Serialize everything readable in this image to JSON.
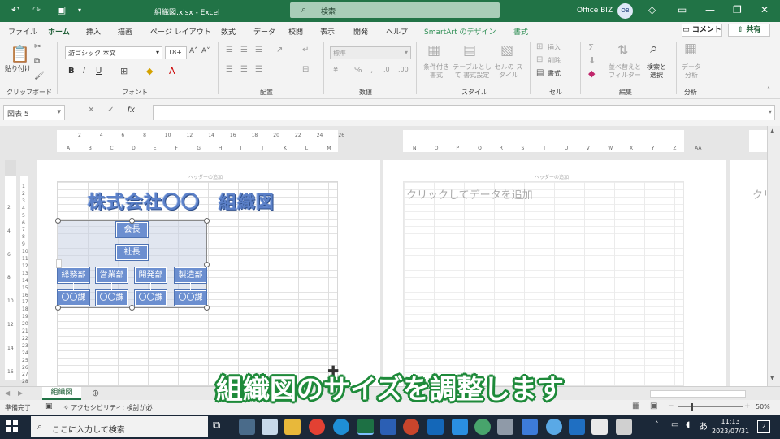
{
  "titlebar": {
    "file_title": "組織図.xlsx - Excel",
    "search_label": "検索",
    "user_name": "Office BIZ",
    "avatar_initials": "OB",
    "accent": "#217346"
  },
  "menu": {
    "tabs": [
      "ファイル",
      "ホーム",
      "挿入",
      "描画",
      "ページ レイアウト",
      "数式",
      "データ",
      "校閲",
      "表示",
      "開発",
      "ヘルプ",
      "SmartArt のデザイン",
      "書式"
    ],
    "comment_label": "コメント",
    "share_label": "共有"
  },
  "ribbon": {
    "paste_label": "貼り付け",
    "font_name": "游ゴシック 本文",
    "font_size": "18+",
    "number_format": "標準",
    "conditional_label": "条件付き 書式",
    "table_format_label": "テーブルとして 書式設定",
    "cell_style_label": "セルの スタイル",
    "insert_label": "挿入",
    "delete_label": "削除",
    "format_label": "書式",
    "sort_label": "並べ替えと フィルター",
    "find_label": "検索と 選択",
    "analyze_label": "データ 分析",
    "groups": [
      "クリップボード",
      "フォント",
      "配置",
      "数値",
      "スタイル",
      "セル",
      "編集",
      "分析"
    ]
  },
  "formula_bar": {
    "name_box": "図表 5",
    "fx": "fx"
  },
  "ruler": {
    "left_numbers": [
      "2",
      "4",
      "6",
      "8",
      "10",
      "12",
      "14",
      "16",
      "18",
      "20",
      "22",
      "24",
      "26"
    ],
    "left_columns": [
      "A",
      "B",
      "C",
      "D",
      "E",
      "F",
      "G",
      "H",
      "I",
      "J",
      "K",
      "L",
      "M"
    ],
    "right_columns": [
      "N",
      "O",
      "P",
      "Q",
      "R",
      "S",
      "T",
      "U",
      "V",
      "W",
      "X",
      "Y",
      "Z",
      "AA"
    ],
    "row_numbers": [
      "1",
      "2",
      "3",
      "4",
      "5",
      "6",
      "7",
      "8",
      "9",
      "10",
      "11",
      "12",
      "13",
      "14",
      "15",
      "16",
      "17",
      "18",
      "19",
      "20",
      "21",
      "22",
      "23",
      "24",
      "25",
      "26",
      "27",
      "28"
    ],
    "vertical_numbers": [
      "2",
      "4",
      "6",
      "8",
      "10",
      "12",
      "14",
      "16"
    ]
  },
  "page": {
    "header_add": "ヘッダーの追加",
    "click_to_add": "クリックしてデータを追加",
    "click_partial": "クリ"
  },
  "org_chart": {
    "title": "株式会社〇〇　組織図",
    "top_nodes": [
      "会長",
      "社長"
    ],
    "departments": [
      "総務部",
      "営業部",
      "開発部",
      "製造部"
    ],
    "sections": [
      "〇〇課",
      "〇〇課",
      "〇〇課",
      "〇〇課"
    ],
    "node_color": "#6c8fd0"
  },
  "sheet": {
    "tab_name": "組織図"
  },
  "status": {
    "ready": "準備完了",
    "accessibility": "アクセシビリティ: 検討が必",
    "zoom": "50%"
  },
  "subtitle": "組織図のサイズを調整します",
  "taskbar": {
    "search_placeholder": "ここに入力して検索",
    "time": "11:13",
    "date": "2023/07/31",
    "ime": "あ",
    "notifications": "2"
  }
}
